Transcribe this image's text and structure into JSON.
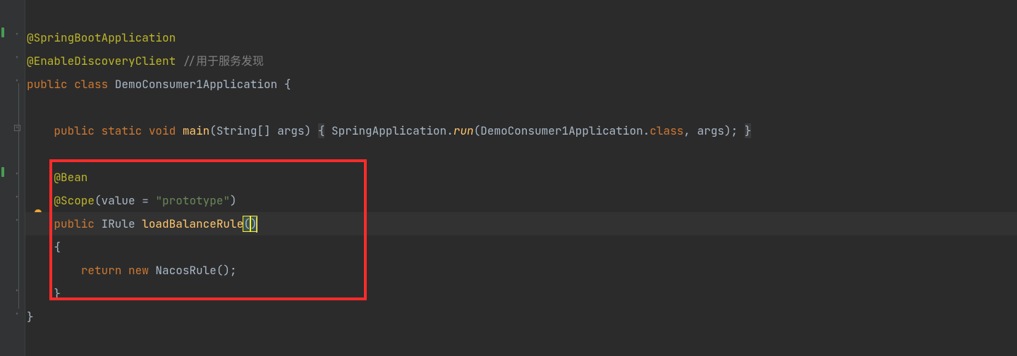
{
  "code": {
    "l1_anno1": "@SpringBootApplication",
    "l2_anno": "@EnableDiscoveryClient",
    "l2_comment": " //用于服务发现",
    "l3_public": "public ",
    "l3_class": "class ",
    "l3_name": "DemoConsumer1Application ",
    "l3_brace": "{",
    "l5_public": "public ",
    "l5_static": "static ",
    "l5_void": "void ",
    "l5_main": "main",
    "l5_params": "(String[] args) ",
    "l5_fold_open": "{",
    "l5_body1": " SpringApplication.",
    "l5_run": "run",
    "l5_body2": "(DemoConsumer1Application.",
    "l5_classkw": "class",
    "l5_body3": ", args); ",
    "l5_fold_close": "}",
    "l7_bean": "@Bean",
    "l8_scope": "@Scope",
    "l8_paren_open": "(",
    "l8_value": "value = ",
    "l8_str": "\"prototype\"",
    "l8_paren_close": ")",
    "l9_public": "public ",
    "l9_type": "IRule ",
    "l9_method": "loadBalanceRule",
    "l9_paren_open": "(",
    "l9_paren_close": ")",
    "l10_brace": "{",
    "l11_return": "return ",
    "l11_new": "new ",
    "l11_call": "NacosRule();",
    "l12_brace": "}",
    "l13_brace": "}"
  }
}
